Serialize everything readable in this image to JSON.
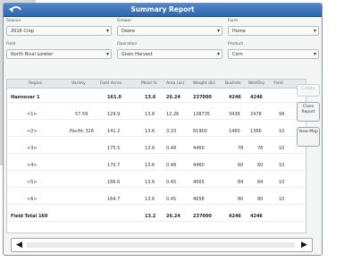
{
  "window": {
    "title": "Summary Report"
  },
  "filters": {
    "season": {
      "label": "Season",
      "value": "2016 Crop"
    },
    "grower": {
      "label": "Grower",
      "value": "Deere"
    },
    "farm": {
      "label": "Farm",
      "value": "Home"
    },
    "field": {
      "label": "Field",
      "value": "North Rival Loreter"
    },
    "operation": {
      "label": "Operation",
      "value": "Grain Harvest"
    },
    "product": {
      "label": "Product",
      "value": "Corn"
    }
  },
  "table": {
    "headers": [
      "Region",
      "Variety",
      "Field Acres",
      "Moist.%",
      "Area (ac)",
      "Weight (lb)",
      "Bushels",
      "Wet/Dry",
      "Yield"
    ],
    "rows": [
      {
        "type": "group",
        "cells": [
          "Hannover 1",
          "",
          "161.0",
          "13.6",
          "26.24",
          "237000",
          "4246",
          "4246",
          ""
        ]
      },
      {
        "type": "data",
        "cells": [
          "<1>",
          "57.59",
          "129.9",
          "13.6",
          "12.26",
          "138735",
          "3438",
          "2478",
          "99"
        ]
      },
      {
        "type": "data",
        "cells": [
          "<2>",
          "Pacific 326",
          "141.2",
          "13.6",
          "3.33",
          "81900",
          "1460",
          "1366",
          "10"
        ]
      },
      {
        "type": "data",
        "cells": [
          "<3>",
          "",
          "175.5",
          "13.6",
          "0.48",
          "4460",
          "78",
          "78",
          "10"
        ]
      },
      {
        "type": "data",
        "cells": [
          "<4>",
          "",
          "170.7",
          "13.6",
          "0.48",
          "4460",
          "60",
          "60",
          "10"
        ]
      },
      {
        "type": "data",
        "cells": [
          "<5>",
          "",
          "186.6",
          "13.6",
          "0.45",
          "4665",
          "84",
          "84",
          "10"
        ]
      },
      {
        "type": "data",
        "cells": [
          "<6>",
          "",
          "164.7",
          "13.6",
          "0.45",
          "4658",
          "80",
          "80",
          "10"
        ]
      },
      {
        "type": "total",
        "cells": [
          "Field Total 160",
          "",
          "",
          "13.2",
          "26.24",
          "237000",
          "4246",
          "4246",
          ""
        ]
      }
    ]
  },
  "sidebar": {
    "create_label": "Create",
    "close_report_label": "Close Report",
    "view_map_label": "View Map"
  },
  "scrollbar": {
    "left_arrow": "◀",
    "right_arrow": "▶"
  },
  "colors": {
    "title_bar": "#3a74ba",
    "screen_bg": "#f4f5f5"
  }
}
